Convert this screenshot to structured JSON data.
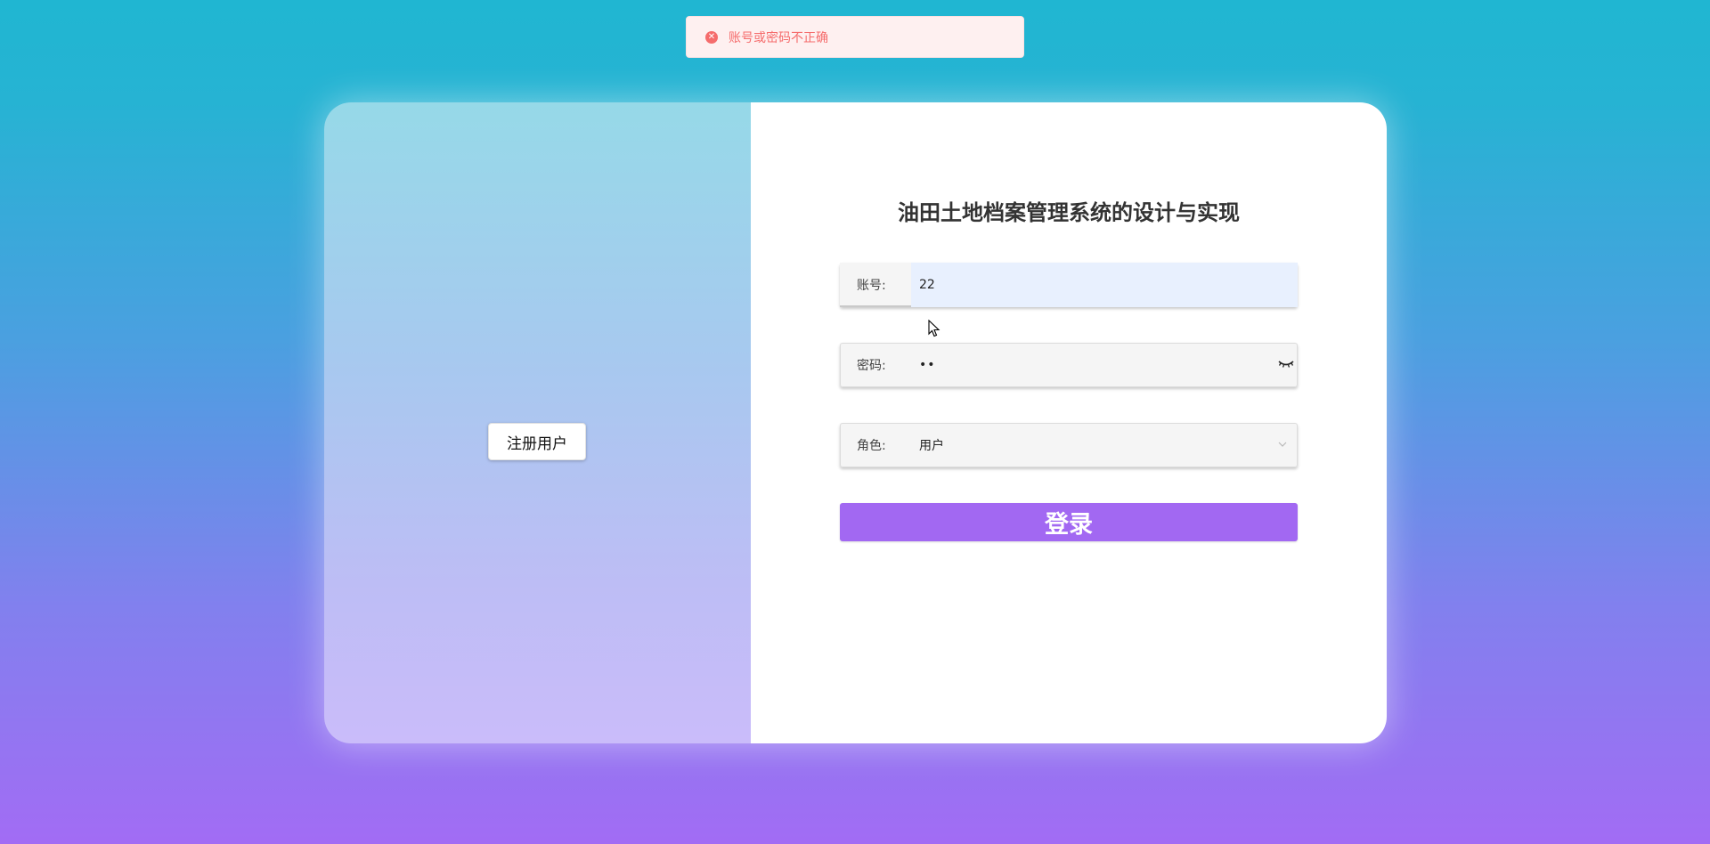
{
  "toast": {
    "message": "账号或密码不正确",
    "icon": "close-circle-icon",
    "color": "#f56c6c"
  },
  "left_panel": {
    "register_label": "注册用户"
  },
  "form": {
    "title": "油田土地档案管理系统的设计与实现",
    "account": {
      "label": "账号:",
      "value": "22"
    },
    "password": {
      "label": "密码:",
      "value": "••",
      "toggle_icon": "eye-closed-icon"
    },
    "role": {
      "label": "角色:",
      "selected": "用户",
      "icon": "chevron-down-icon"
    },
    "login_label": "登录"
  },
  "colors": {
    "accent": "#a268f2",
    "error": "#f56c6c",
    "autofill": "#e8f0fe"
  }
}
